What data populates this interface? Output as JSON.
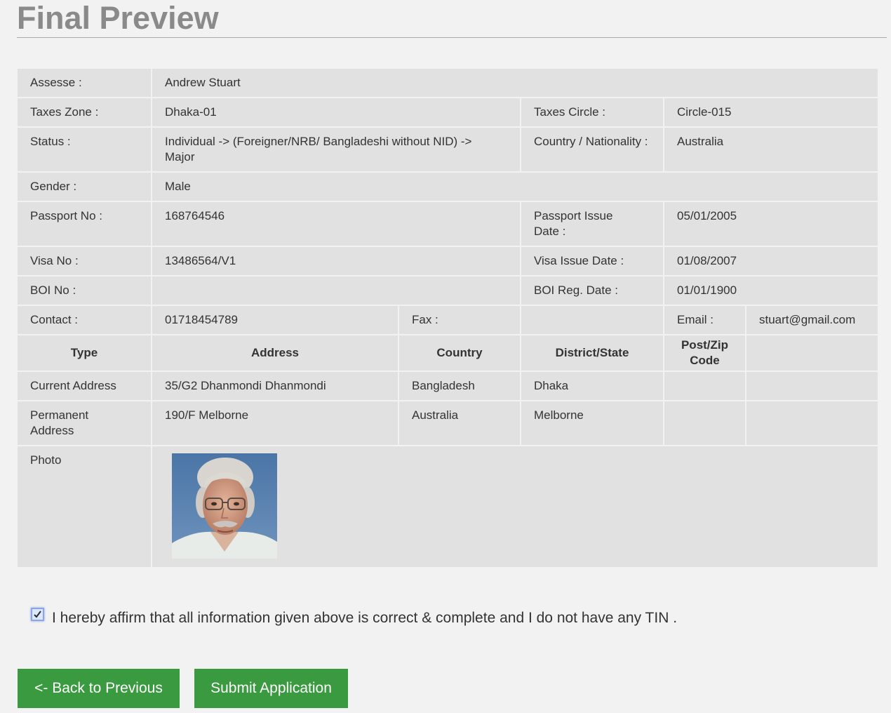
{
  "page": {
    "title": "Final Preview"
  },
  "fields": {
    "assesse_label": "Assesse :",
    "assesse": "Andrew Stuart",
    "taxes_zone_label": "Taxes Zone :",
    "taxes_zone": "Dhaka-01",
    "taxes_circle_label": "Taxes Circle :",
    "taxes_circle": "Circle-015",
    "status_label": "Status :",
    "status": "Individual -> (Foreigner/NRB/ Bangladeshi without NID) -> Major",
    "country_label": "Country / Nationality :",
    "country": "Australia",
    "gender_label": "Gender :",
    "gender": "Male",
    "passport_no_label": "Passport No :",
    "passport_no": "168764546",
    "passport_issue_label": "Passport Issue Date :",
    "passport_issue": "05/01/2005",
    "visa_no_label": "Visa No :",
    "visa_no": "13486564/V1",
    "visa_issue_label": "Visa Issue Date :",
    "visa_issue": "01/08/2007",
    "boi_no_label": "BOI No :",
    "boi_no": "",
    "boi_reg_label": "BOI Reg. Date :",
    "boi_reg": "01/01/1900",
    "contact_label": "Contact :",
    "contact": "01718454789",
    "fax_label": "Fax :",
    "fax": "",
    "email_label": "Email :",
    "email": "stuart@gmail.com"
  },
  "address_table": {
    "headers": [
      "Type",
      "Address",
      "Country",
      "District/State",
      "Post/Zip Code"
    ],
    "rows": [
      {
        "type": "Current Address",
        "address": "35/G2 Dhanmondi Dhanmondi",
        "country": "Bangladesh",
        "district": "Dhaka",
        "zip": ""
      },
      {
        "type": "Permanent Address",
        "address": "190/F Melborne",
        "country": "Australia",
        "district": "Melborne",
        "zip": ""
      }
    ]
  },
  "photo": {
    "label": "Photo"
  },
  "affirmation": {
    "text": "I hereby affirm that all information given above is correct & complete and I do not have any TIN .",
    "checked": true
  },
  "buttons": {
    "back": "<- Back to Previous",
    "submit": "Submit Application"
  },
  "colors": {
    "button": "#3a9a40",
    "table_bg": "#e1e1e1",
    "page_bg": "#f2f2f2",
    "title": "#8a8a8a"
  }
}
